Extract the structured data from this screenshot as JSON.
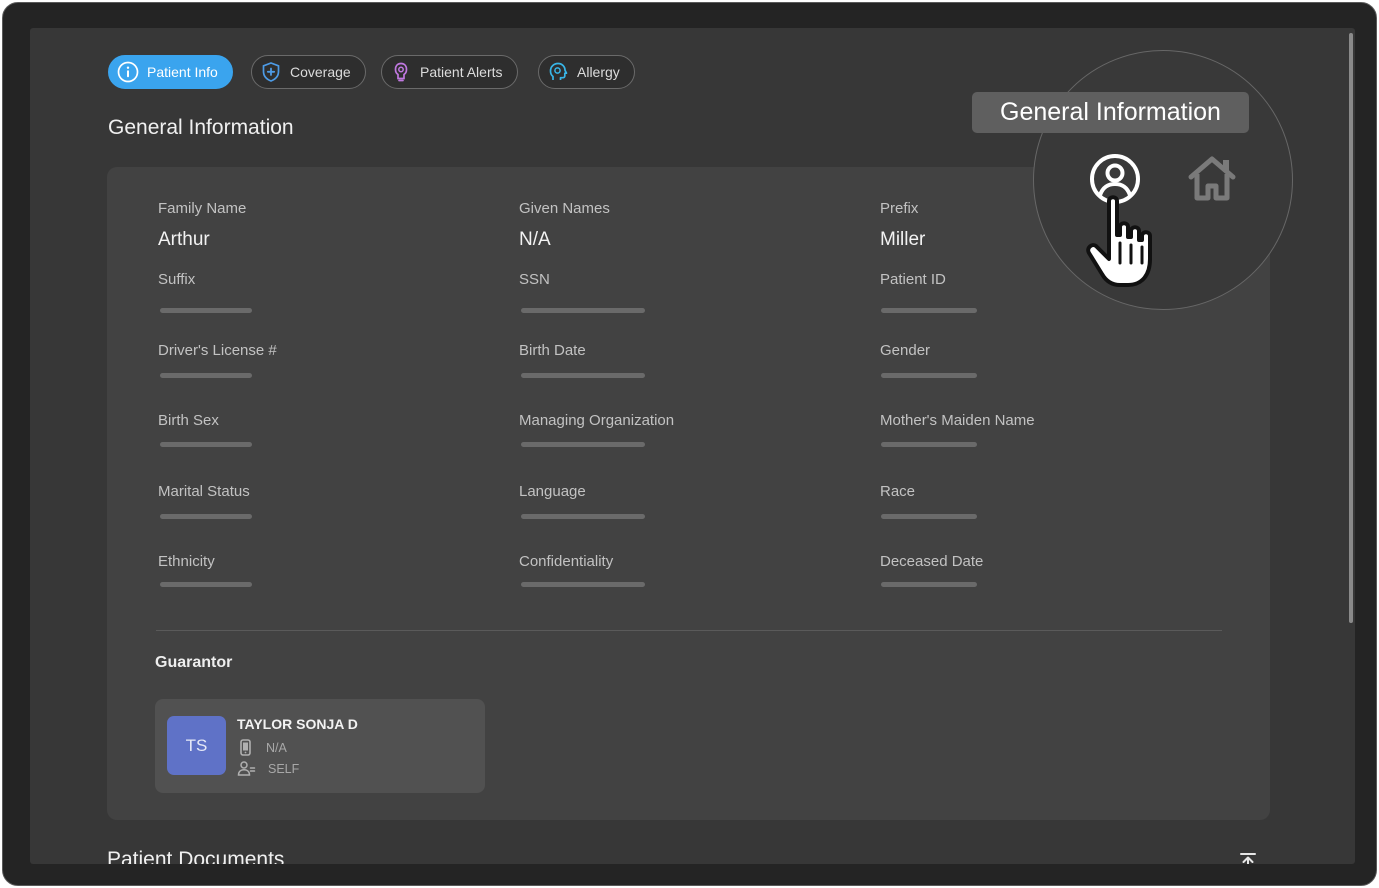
{
  "tabs": [
    {
      "label": "Patient Info",
      "icon": "info-icon",
      "active": true
    },
    {
      "label": "Coverage",
      "icon": "shield-plus-icon",
      "active": false
    },
    {
      "label": "Patient Alerts",
      "icon": "alert-bell-icon",
      "active": false
    },
    {
      "label": "Allergy",
      "icon": "allergy-head-icon",
      "active": false
    }
  ],
  "general": {
    "title": "General Information",
    "family_name": {
      "label": "Family Name",
      "value": "Arthur"
    },
    "given_names": {
      "label": "Given Names",
      "value": "N/A"
    },
    "prefix": {
      "label": "Prefix",
      "value": "Miller"
    },
    "suffix": {
      "label": "Suffix"
    },
    "ssn": {
      "label": "SSN"
    },
    "patient_id": {
      "label": "Patient ID"
    },
    "drivers_license": {
      "label": "Driver's License #"
    },
    "birth_date": {
      "label": "Birth Date"
    },
    "gender": {
      "label": "Gender"
    },
    "birth_sex": {
      "label": "Birth Sex"
    },
    "managing_org": {
      "label": "Managing Organization"
    },
    "mothers_maiden": {
      "label": "Mother's Maiden Name"
    },
    "marital_status": {
      "label": "Marital Status"
    },
    "language": {
      "label": "Language"
    },
    "race": {
      "label": "Race"
    },
    "ethnicity": {
      "label": "Ethnicity"
    },
    "confidentiality": {
      "label": "Confidentiality"
    },
    "deceased_date": {
      "label": "Deceased Date"
    }
  },
  "guarantor": {
    "title": "Guarantor",
    "initials": "TS",
    "name": "TAYLOR SONJA D",
    "phone": "N/A",
    "relationship": "SELF"
  },
  "documents": {
    "title": "Patient Documents"
  },
  "tooltip": {
    "text": "General Information"
  },
  "icons": [
    "user-circle-icon",
    "home-icon",
    "pointer-hand-icon",
    "phone-icon",
    "user-group-icon",
    "scroll-top-icon"
  ],
  "colors": {
    "accent": "#3aa4ee",
    "avatar": "#5f72c7",
    "background": "#373737",
    "card": "#424242"
  }
}
